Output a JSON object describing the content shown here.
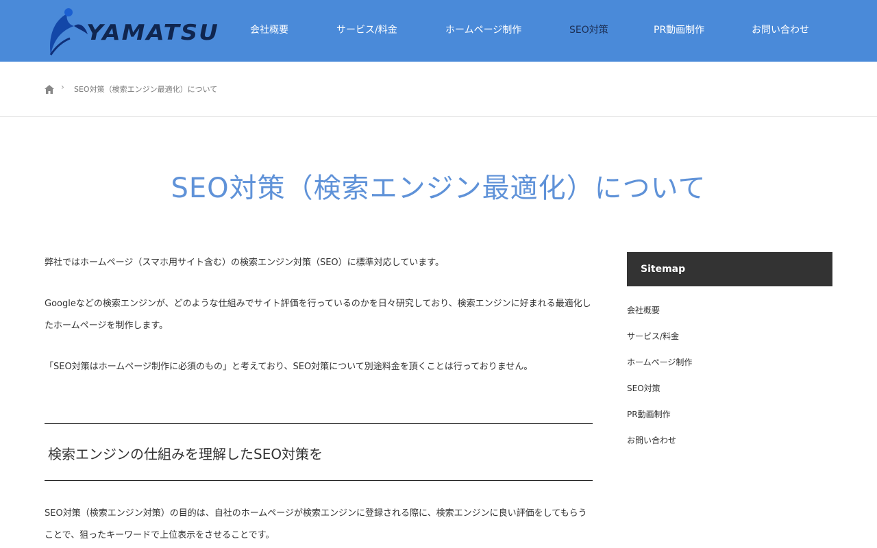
{
  "header": {
    "logo_text": "YAMATSU",
    "nav": [
      {
        "label": "会社概要"
      },
      {
        "label": "サービス/料金"
      },
      {
        "label": "ホームページ制作"
      },
      {
        "label": "SEO対策"
      },
      {
        "label": "PR動画制作"
      },
      {
        "label": "お問い合わせ"
      }
    ]
  },
  "breadcrumb": {
    "home_icon": "home-icon",
    "separator": "›",
    "current": "SEO対策（検索エンジン最適化）について"
  },
  "page": {
    "title": "SEO対策（検索エンジン最適化）について"
  },
  "main": {
    "paragraphs": [
      "弊社ではホームページ（スマホ用サイト含む）の検索エンジン対策（SEO）に標準対応しています。",
      "Googleなどの検索エンジンが、どのような仕組みでサイト評価を行っているのかを日々研究しており、検索エンジンに好まれる最適化したホームページを制作します。",
      "「SEO対策はホームページ制作に必須のもの」と考えており、SEO対策について別途料金を頂くことは行っておりません。"
    ],
    "section_heading": "検索エンジンの仕組みを理解したSEO対策を",
    "section_paragraph": "SEO対策（検索エンジン対策）の目的は、自社のホームページが検索エンジンに登録される際に、検索エンジンに良い評価をしてもらうことで、狙ったキーワードで上位表示をさせることです。"
  },
  "sidebar": {
    "title": "Sitemap",
    "links": [
      {
        "label": "会社概要"
      },
      {
        "label": "サービス/料金"
      },
      {
        "label": "ホームページ制作"
      },
      {
        "label": "SEO対策"
      },
      {
        "label": "PR動画制作"
      },
      {
        "label": "お問い合わせ"
      }
    ]
  },
  "colors": {
    "header_bg": "#4a8ad9",
    "title": "#5f92d8",
    "sidebar_title_bg": "#333333",
    "active_nav": "#1c2f55"
  }
}
